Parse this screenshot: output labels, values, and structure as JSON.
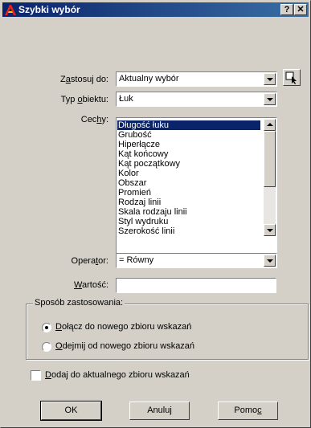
{
  "window": {
    "title": "Szybki wybór"
  },
  "titlebar_buttons": {
    "help": "?",
    "close": "✕"
  },
  "form": {
    "apply_to": {
      "label_pre": "Z",
      "label_u": "a",
      "label_post": "stosuj do:",
      "value": "Aktualny wybór"
    },
    "object_type": {
      "label_pre": "Typ ",
      "label_u": "o",
      "label_post": "biektu:",
      "value": "Łuk"
    },
    "properties": {
      "label_pre": "Cec",
      "label_u": "h",
      "label_post": "y:",
      "items": [
        "Długość łuku",
        "Grubość",
        "Hiperłącze",
        "Kąt końcowy",
        "Kąt początkowy",
        "Kolor",
        "Obszar",
        "Promień",
        "Rodzaj linii",
        "Skala rodzaju linii",
        "Styl wydruku",
        "Szerokość linii"
      ],
      "selected_index": 0
    },
    "operator": {
      "label_pre": "Opera",
      "label_u": "t",
      "label_post": "or:",
      "value": "= Równy"
    },
    "value": {
      "label_pre": "",
      "label_u": "W",
      "label_post": "artość:",
      "value": ""
    }
  },
  "apply_group": {
    "title": "Sposób zastosowania:",
    "options": [
      {
        "label_u": "D",
        "label_post": "ołącz do nowego zbioru wskazań",
        "checked": true
      },
      {
        "label_u": "O",
        "label_post": "dejmij od nowego zbioru wskazań",
        "checked": false
      }
    ]
  },
  "append": {
    "label_u": "D",
    "label_post": "odaj do aktualnego zbioru wskazań",
    "checked": false
  },
  "buttons": {
    "ok": "OK",
    "cancel": "Anuluj",
    "help_pre": "Pomo",
    "help_u": "c"
  }
}
